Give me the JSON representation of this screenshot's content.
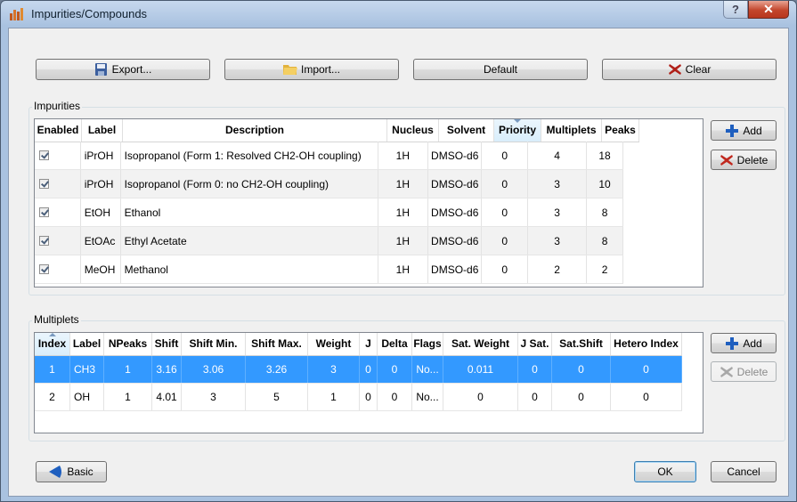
{
  "window": {
    "title": "Impurities/Compounds",
    "help_glyph": "?",
    "close_glyph": "✕"
  },
  "toolbar": {
    "export_label": "Export...",
    "import_label": "Import...",
    "default_label": "Default",
    "clear_label": "Clear"
  },
  "impurities": {
    "group_label": "Impurities",
    "columns": [
      "Enabled",
      "Label",
      "Description",
      "Nucleus",
      "Solvent",
      "Priority",
      "Multiplets",
      "Peaks"
    ],
    "rows": [
      {
        "enabled": true,
        "label": "iPrOH",
        "description": "Isopropanol (Form 1: Resolved CH2-OH coupling)",
        "nucleus": "1H",
        "solvent": "DMSO-d6",
        "priority": "0",
        "multiplets": "4",
        "peaks": "18"
      },
      {
        "enabled": true,
        "label": "iPrOH",
        "description": "Isopropanol (Form 0: no CH2-OH coupling)",
        "nucleus": "1H",
        "solvent": "DMSO-d6",
        "priority": "0",
        "multiplets": "3",
        "peaks": "10"
      },
      {
        "enabled": true,
        "label": "EtOH",
        "description": "Ethanol",
        "nucleus": "1H",
        "solvent": "DMSO-d6",
        "priority": "0",
        "multiplets": "3",
        "peaks": "8"
      },
      {
        "enabled": true,
        "label": "EtOAc",
        "description": "Ethyl Acetate",
        "nucleus": "1H",
        "solvent": "DMSO-d6",
        "priority": "0",
        "multiplets": "3",
        "peaks": "8"
      },
      {
        "enabled": true,
        "label": "MeOH",
        "description": "Methanol",
        "nucleus": "1H",
        "solvent": "DMSO-d6",
        "priority": "0",
        "multiplets": "2",
        "peaks": "2"
      }
    ],
    "add_label": "Add",
    "delete_label": "Delete"
  },
  "multiplets": {
    "group_label": "Multiplets",
    "columns": [
      "Index",
      "Label",
      "NPeaks",
      "Shift",
      "Shift Min.",
      "Shift Max.",
      "Weight",
      "J",
      "Delta",
      "Flags",
      "Sat. Weight",
      "J Sat.",
      "Sat.Shift",
      "Hetero Index"
    ],
    "rows": [
      {
        "selected": true,
        "cells": [
          "1",
          "CH3",
          "1",
          "3.16",
          "3.06",
          "3.26",
          "3",
          "0",
          "0",
          "No...",
          "0.011",
          "0",
          "0",
          "0"
        ]
      },
      {
        "selected": false,
        "cells": [
          "2",
          "OH",
          "1",
          "4.01",
          "3",
          "5",
          "1",
          "0",
          "0",
          "No...",
          "0",
          "0",
          "0",
          "0"
        ]
      }
    ],
    "add_label": "Add",
    "delete_label": "Delete"
  },
  "footer": {
    "basic_label": "Basic",
    "ok_label": "OK",
    "cancel_label": "Cancel"
  },
  "colors": {
    "selection": "#3399ff",
    "add_icon": "#1f5fbf",
    "delete_icon": "#c0281e",
    "accent_titlebar": "#a9c2e0"
  }
}
